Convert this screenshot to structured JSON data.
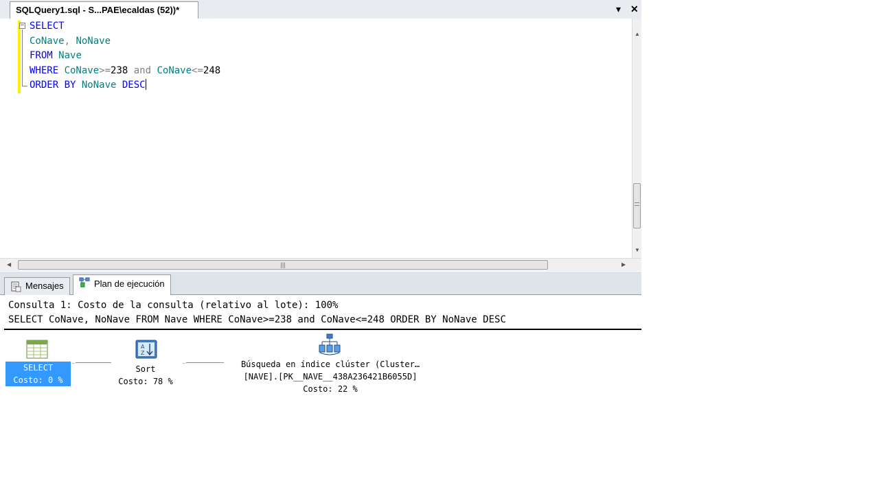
{
  "document_tab": {
    "title": "SQLQuery1.sql - S...PAE\\ecaldas (52))*",
    "menu_glyph": "▾",
    "close_glyph": "✕"
  },
  "editor": {
    "lines": [
      [
        {
          "t": "SELECT",
          "c": "kw"
        }
      ],
      [
        {
          "t": "CoNave",
          "c": "id"
        },
        {
          "t": ", ",
          "c": "op"
        },
        {
          "t": "NoNave",
          "c": "id"
        }
      ],
      [
        {
          "t": "FROM ",
          "c": "kw"
        },
        {
          "t": "Nave",
          "c": "id"
        }
      ],
      [
        {
          "t": "WHERE ",
          "c": "kw"
        },
        {
          "t": "CoNave",
          "c": "id"
        },
        {
          "t": ">=",
          "c": "op"
        },
        {
          "t": "238",
          "c": "num"
        },
        {
          "t": " and ",
          "c": "op"
        },
        {
          "t": "CoNave",
          "c": "id"
        },
        {
          "t": "<=",
          "c": "op"
        },
        {
          "t": "248",
          "c": "num"
        }
      ],
      [
        {
          "t": "ORDER BY ",
          "c": "kw"
        },
        {
          "t": "NoNave ",
          "c": "id"
        },
        {
          "t": "DESC",
          "c": "kw"
        }
      ]
    ]
  },
  "result_tabs": [
    {
      "label": "Mensajes",
      "icon": "messages-icon",
      "active": false
    },
    {
      "label": "Plan de ejecución",
      "icon": "execution-plan-icon",
      "active": true
    }
  ],
  "plan": {
    "header_line1": "Consulta 1: Costo de la consulta (relativo al lote): 100%",
    "header_line2": "SELECT CoNave, NoNave FROM Nave WHERE CoNave>=238 and CoNave<=248 ORDER BY NoNave DESC",
    "nodes": [
      {
        "name": "SELECT",
        "cost": "Costo: 0 %",
        "icon": "select-result-icon",
        "selected": true
      },
      {
        "name": "Sort",
        "cost": "Costo: 78 %",
        "icon": "sort-icon",
        "selected": false
      },
      {
        "name": "Búsqueda en índice clúster (Cluster…",
        "detail": "[NAVE].[PK__NAVE__438A236421B6055D]",
        "cost": "Costo: 22 %",
        "icon": "clustered-index-seek-icon",
        "selected": false
      }
    ]
  },
  "colors": {
    "keyword": "#0000ff",
    "identifier": "#008080",
    "operator": "#808080",
    "selection": "#3399ff",
    "change_bar": "#ffef00"
  }
}
